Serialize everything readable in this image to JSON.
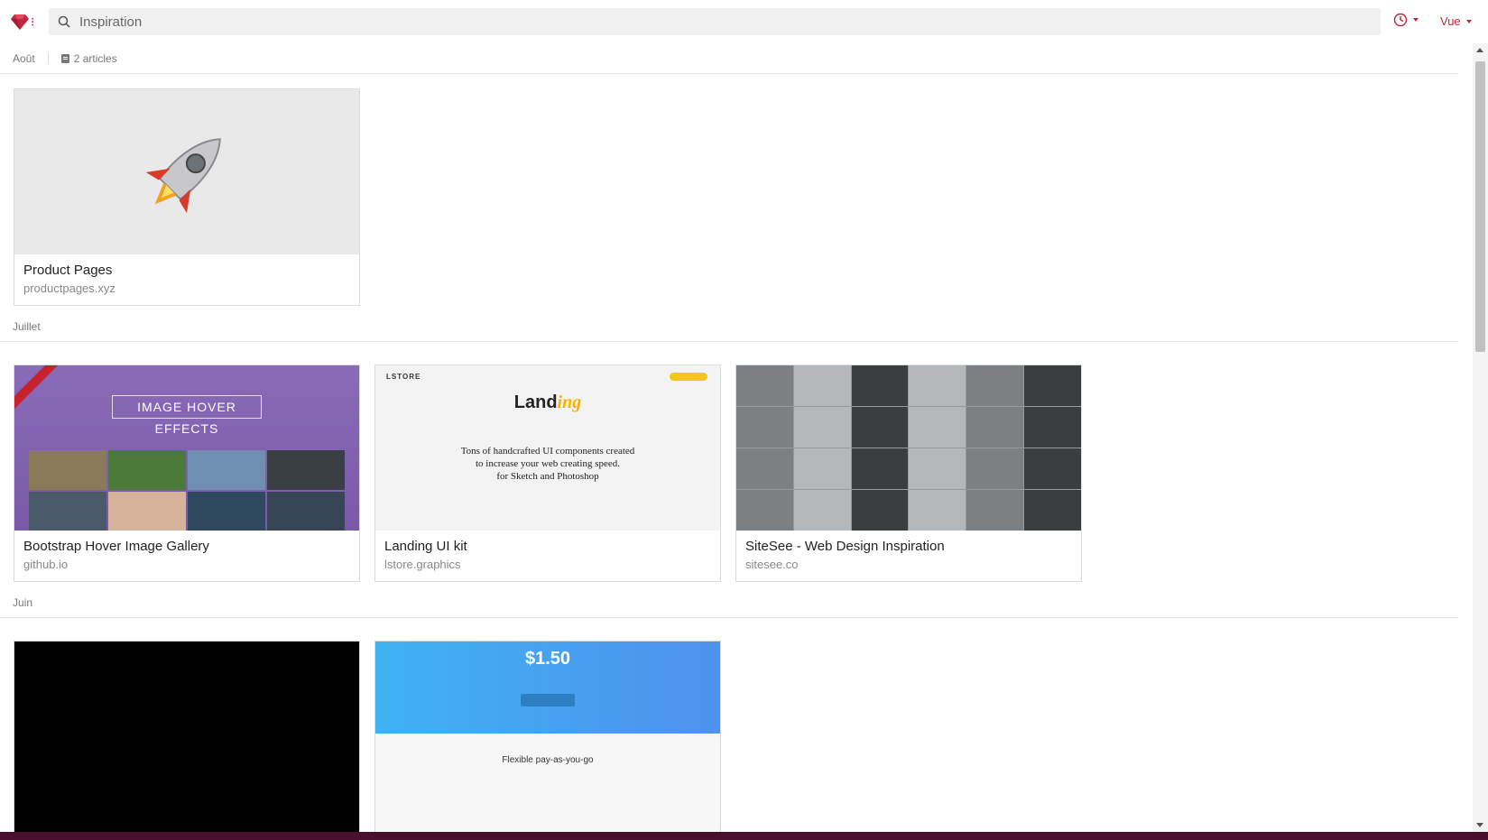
{
  "header": {
    "search_placeholder": "Inspiration",
    "view_label": "Vue"
  },
  "colors": {
    "accent": "#c0273b",
    "statusbar": "#4a0e2e"
  },
  "groups": [
    {
      "label": "Août",
      "count_label": "2 articles",
      "cards": [
        {
          "title": "Product Pages",
          "domain": "productpages.xyz",
          "thumb": "rocket-emoji"
        }
      ]
    },
    {
      "label": "Juillet",
      "cards": [
        {
          "title": "Bootstrap Hover Image Gallery",
          "domain": "github.io",
          "thumb": "hover-effects",
          "thumb_text": "IMAGE HOVER EFFECTS"
        },
        {
          "title": "Landing UI kit",
          "domain": "lstore.graphics",
          "thumb": "landing-kit",
          "thumb_brand": "LSTORE",
          "thumb_name_a": "Land",
          "thumb_name_b": "ing",
          "thumb_text_1": "Tons of  handcrafted UI components created",
          "thumb_text_2": "to increase your web creating speed.",
          "thumb_text_3": "for Sketch and Photoshop"
        },
        {
          "title": "SiteSee - Web Design Inspiration",
          "domain": "sitesee.co",
          "thumb": "sitesee-grid"
        }
      ]
    },
    {
      "label": "Juin",
      "cards": [
        {
          "title": "",
          "domain": "",
          "thumb": "black"
        },
        {
          "title": "",
          "domain": "",
          "thumb": "pricing",
          "thumb_price": "$1.50",
          "thumb_heading": "Flexible pay-as-you-go"
        }
      ]
    }
  ]
}
